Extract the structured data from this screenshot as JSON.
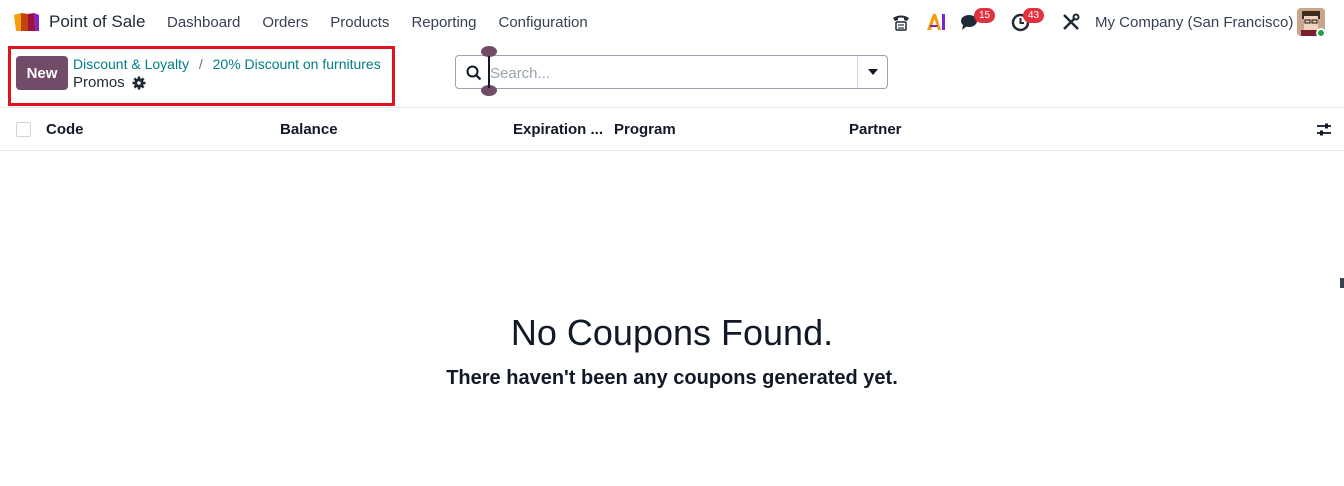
{
  "navbar": {
    "app_name": "Point of Sale",
    "menu": [
      "Dashboard",
      "Orders",
      "Products",
      "Reporting",
      "Configuration"
    ],
    "messages_count": "15",
    "activities_count": "43",
    "company": "My Company (San Francisco)",
    "icons": [
      "pos-logo-icon",
      "phone-icon",
      "ai-icon",
      "chat-icon",
      "clock-icon",
      "tools-icon",
      "avatar"
    ]
  },
  "control_panel": {
    "new_label": "New",
    "breadcrumb": [
      "Discount & Loyalty",
      "20% Discount on furnitures"
    ],
    "breadcrumb_separator": "/",
    "title": "Promos"
  },
  "search": {
    "placeholder": "Search..."
  },
  "table": {
    "columns": [
      "Code",
      "Balance",
      "Expiration ...",
      "Program",
      "Partner"
    ]
  },
  "empty_state": {
    "title": "No Coupons Found.",
    "subtitle": "There haven't been any coupons generated yet."
  },
  "colors": {
    "primary": "#714b67",
    "link": "#017e84",
    "badge": "#e0323f",
    "highlight": "#e0141e"
  }
}
